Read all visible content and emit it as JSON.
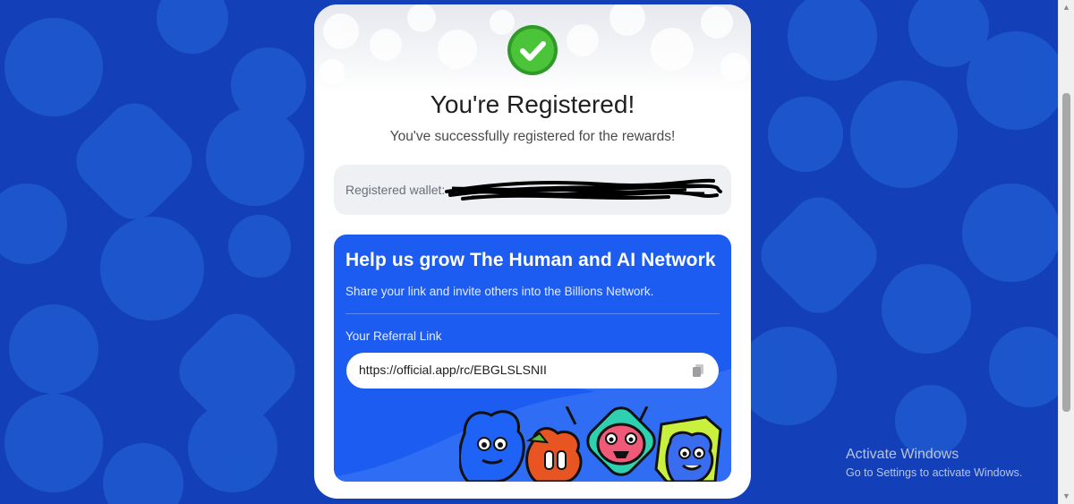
{
  "registration": {
    "title": "You're Registered!",
    "subtitle": "You've successfully registered for the rewards!",
    "wallet_label": "Registered wallet:",
    "success_icon": "check-circle-icon"
  },
  "promo": {
    "heading": "Help us grow The Human and AI Network",
    "description": "Share your link and invite others into the Billions Network.",
    "referral_label": "Your Referral Link",
    "referral_link": "https://official.app/rc/EBGLSLSNII",
    "copy_icon": "copy-icon",
    "accent_color": "#1d5cf0"
  },
  "os_watermark": {
    "line1": "Activate Windows",
    "line2": "Go to Settings to activate Windows."
  },
  "colors": {
    "page_background": "#1340b8",
    "success_green": "#4cc43a"
  }
}
